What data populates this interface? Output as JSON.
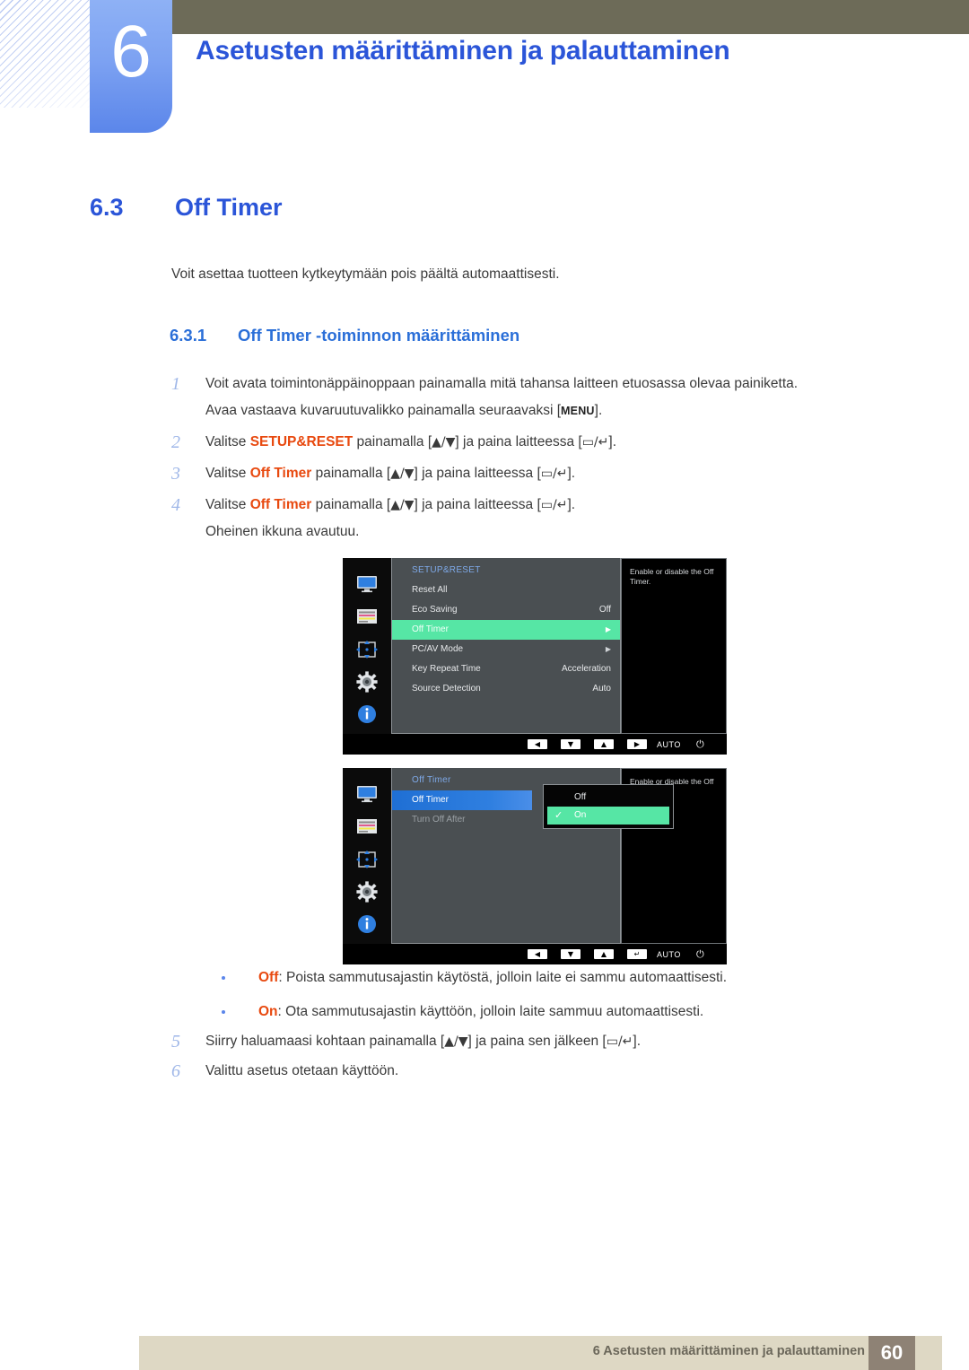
{
  "header": {
    "chapter_number": "6",
    "chapter_title": "Asetusten määrittäminen ja palauttaminen"
  },
  "section": {
    "number": "6.3",
    "title": "Off Timer",
    "intro": "Voit asettaa tuotteen kytkeytymään pois päältä automaattisesti.",
    "subsection_number": "6.3.1",
    "subsection_title": "Off Timer -toiminnon määrittäminen"
  },
  "steps": [
    {
      "num": "1",
      "line1": "Voit avata toimintonäppäinoppaan painamalla mitä tahansa laitteen etuosassa olevaa painiketta.",
      "line2_pre": "Avaa vastaava kuvaruutuvalikko painamalla seuraavaksi [",
      "line2_key": "MENU",
      "line2_post": "]."
    },
    {
      "num": "2",
      "pre": "Valitse ",
      "hl": "SETUP&RESET",
      "mid": " painamalla [",
      "keys": "▲/▼",
      "mid2": "] ja paina laitteessa [",
      "keys2": "▭/↵",
      "post": "]."
    },
    {
      "num": "3",
      "pre": "Valitse ",
      "hl": "Off Timer",
      "mid": " painamalla [",
      "keys": "▲/▼",
      "mid2": "] ja paina laitteessa [",
      "keys2": "▭/↵",
      "post": "]."
    },
    {
      "num": "4",
      "pre": "Valitse ",
      "hl": "Off Timer",
      "mid": " painamalla [",
      "keys": "▲/▼",
      "mid2": "] ja paina laitteessa [",
      "keys2": "▭/↵",
      "post": "].",
      "note": "Oheinen ikkuna avautuu."
    }
  ],
  "osd1": {
    "title": "SETUP&RESET",
    "rows": [
      {
        "label": "Reset All",
        "value": "",
        "caret": "",
        "state": "normal"
      },
      {
        "label": "Eco Saving",
        "value": "Off",
        "caret": "",
        "state": "normal"
      },
      {
        "label": "Off Timer",
        "value": "",
        "caret": "▶",
        "state": "selected-green"
      },
      {
        "label": "PC/AV Mode",
        "value": "",
        "caret": "▶",
        "state": "normal"
      },
      {
        "label": "Key Repeat Time",
        "value": "Acceleration",
        "caret": "",
        "state": "normal"
      },
      {
        "label": "Source Detection",
        "value": "Auto",
        "caret": "",
        "state": "normal"
      }
    ],
    "description": "Enable or disable the Off Timer.",
    "icons": [
      "monitor-icon",
      "picture-bars-icon",
      "four-way-arrow-icon",
      "gear-icon",
      "info-icon"
    ],
    "buttons": [
      "◀",
      "▼",
      "▲",
      "▶"
    ],
    "auto_label": "AUTO",
    "power_glyph": "⏻"
  },
  "osd2": {
    "title": "Off Timer",
    "rows": [
      {
        "label": "Off Timer",
        "state": "selected-blue"
      },
      {
        "label": "Turn Off After",
        "state": "dim"
      }
    ],
    "dropdown": [
      {
        "label": "Off",
        "checked": false
      },
      {
        "label": "On",
        "checked": true
      }
    ],
    "check_glyph": "✓",
    "description": "Enable or disable the Off Timer.",
    "icons": [
      "monitor-icon",
      "picture-bars-icon",
      "four-way-arrow-icon",
      "gear-icon",
      "info-icon"
    ],
    "buttons": [
      "◀",
      "▼",
      "▲",
      "↵"
    ],
    "auto_label": "AUTO",
    "power_glyph": "⏻"
  },
  "bullets": [
    {
      "hl": "Off",
      "text": ": Poista sammutusajastin käytöstä, jolloin laite ei sammu automaattisesti."
    },
    {
      "hl": "On",
      "text": ": Ota sammutusajastin käyttöön, jolloin laite sammuu automaattisesti."
    }
  ],
  "steps2": [
    {
      "num": "5",
      "pre": "Siirry haluamaasi kohtaan painamalla [",
      "keys": "▲/▼",
      "mid2": "] ja paina sen jälkeen [",
      "keys2": "▭/↵",
      "post": "]."
    },
    {
      "num": "6",
      "pre": "Valittu asetus otetaan käyttöön.",
      "hl": "",
      "mid": "",
      "keys": "",
      "mid2": "",
      "keys2": "",
      "post": ""
    }
  ],
  "footer": {
    "text": "6 Asetusten määrittäminen ja palauttaminen",
    "page": "60"
  }
}
